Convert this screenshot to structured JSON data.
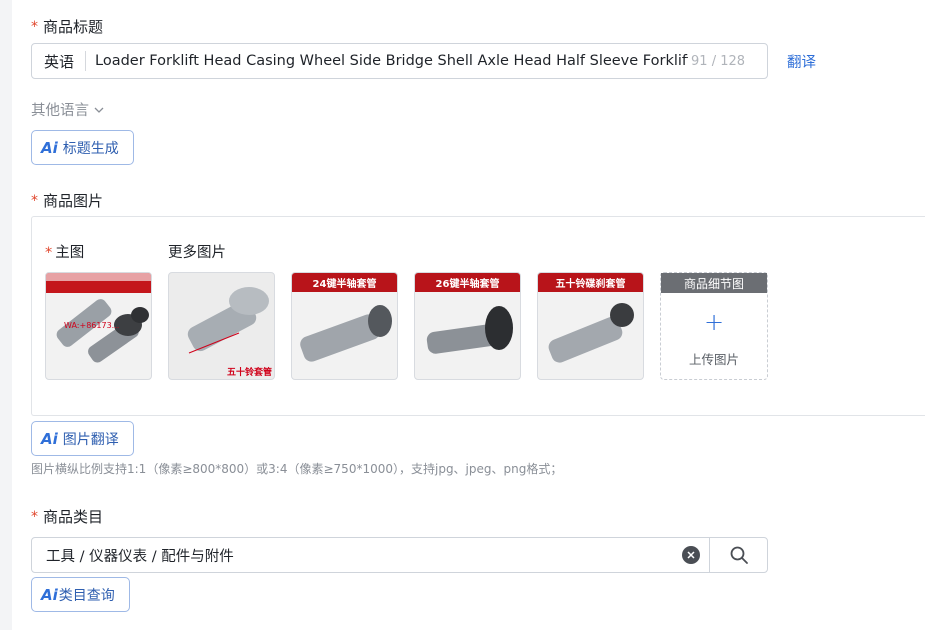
{
  "title_section": {
    "label": "商品标题",
    "lang": "英语",
    "value": "Loader Forklift  Head Casing Wheel Side Bridge Shell Axle Head Half  Sleeve Forklift  She",
    "counter": "91 / 128",
    "translate_label": "翻译"
  },
  "other_lang_label": "其他语言",
  "ai_title_button": "标题生成",
  "images_section": {
    "label": "商品图片",
    "main_label": "主图",
    "more_label": "更多图片",
    "thumbs": [
      {
        "banner": "",
        "watermark": "WA:+86173..."
      },
      {
        "banner": "",
        "caption": "五十铃套管"
      },
      {
        "banner": "24键半轴套管"
      },
      {
        "banner": "26键半轴套管"
      },
      {
        "banner": "五十铃碟刹套管"
      }
    ],
    "detail_label": "商品细节图",
    "upload_label": "上传图片",
    "upload_plus": "+"
  },
  "ai_image_translate_button": "图片翻译",
  "image_hint": "图片横纵比例支持1:1（像素≥800*800）或3:4（像素≥750*1000），支持jpg、jpeg、png格式；",
  "category_section": {
    "label": "商品类目",
    "value": "工具 / 仪器仪表 / 配件与附件"
  },
  "ai_category_button": "类目查询",
  "ai_mark": "Ai",
  "colors": {
    "required": "#e0452b",
    "link": "#2f6fd8",
    "banner": "#b8141a"
  }
}
